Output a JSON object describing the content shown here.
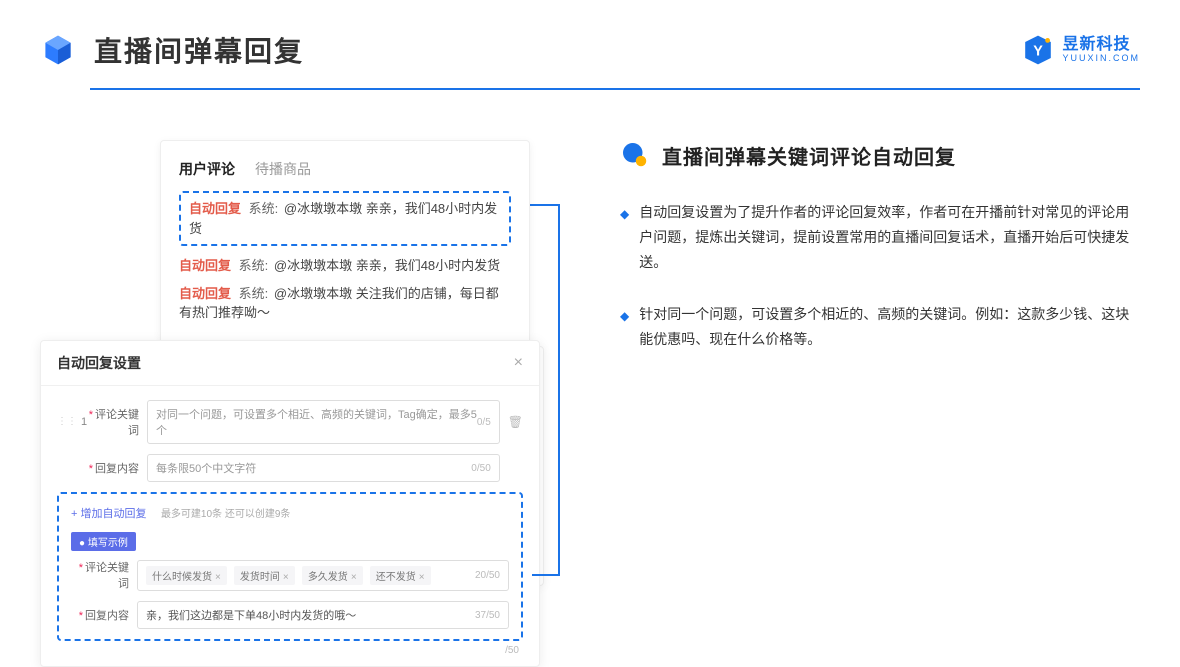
{
  "header": {
    "title": "直播间弹幕回复"
  },
  "logo": {
    "name": "昱新科技",
    "url": "YUUXIN.COM"
  },
  "comment_card": {
    "tabs": {
      "active": "用户评论",
      "inactive": "待播商品"
    },
    "rows": [
      {
        "tag": "自动回复",
        "sys": "系统:",
        "text": "@冰墩墩本墩 亲亲，我们48小时内发货"
      },
      {
        "tag": "自动回复",
        "sys": "系统:",
        "text": "@冰墩墩本墩 亲亲，我们48小时内发货"
      },
      {
        "tag": "自动回复",
        "sys": "系统:",
        "text": "@冰墩墩本墩 关注我们的店铺，每日都有热门推荐呦～"
      }
    ]
  },
  "settings": {
    "title": "自动回复设置",
    "num": "1",
    "label_keyword": "评论关键词",
    "placeholder_keyword": "对同一个问题，可设置多个相近、高频的关键词，Tag确定，最多5个",
    "counter_keyword": "0/5",
    "label_content": "回复内容",
    "placeholder_content": "每条限50个中文字符",
    "counter_content": "0/50",
    "add_link": "+ 增加自动回复",
    "add_hint": "最多可建10条 还可以创建9条",
    "example_badge": "● 填写示例",
    "ex_label_keyword": "评论关键词",
    "ex_tags": [
      "什么时候发货",
      "发货时间",
      "多久发货",
      "还不发货"
    ],
    "ex_counter_keyword": "20/50",
    "ex_label_content": "回复内容",
    "ex_content_value": "亲，我们这边都是下单48小时内发货的哦～",
    "ex_counter_content": "37/50",
    "back_counter": "/50"
  },
  "right": {
    "title": "直播间弹幕关键词评论自动回复",
    "bullets": [
      "自动回复设置为了提升作者的评论回复效率，作者可在开播前针对常见的评论用户问题，提炼出关键词，提前设置常用的直播间回复话术，直播开始后可快捷发送。",
      "针对同一个问题，可设置多个相近的、高频的关键词。例如：这款多少钱、这块能优惠吗、现在什么价格等。"
    ]
  }
}
